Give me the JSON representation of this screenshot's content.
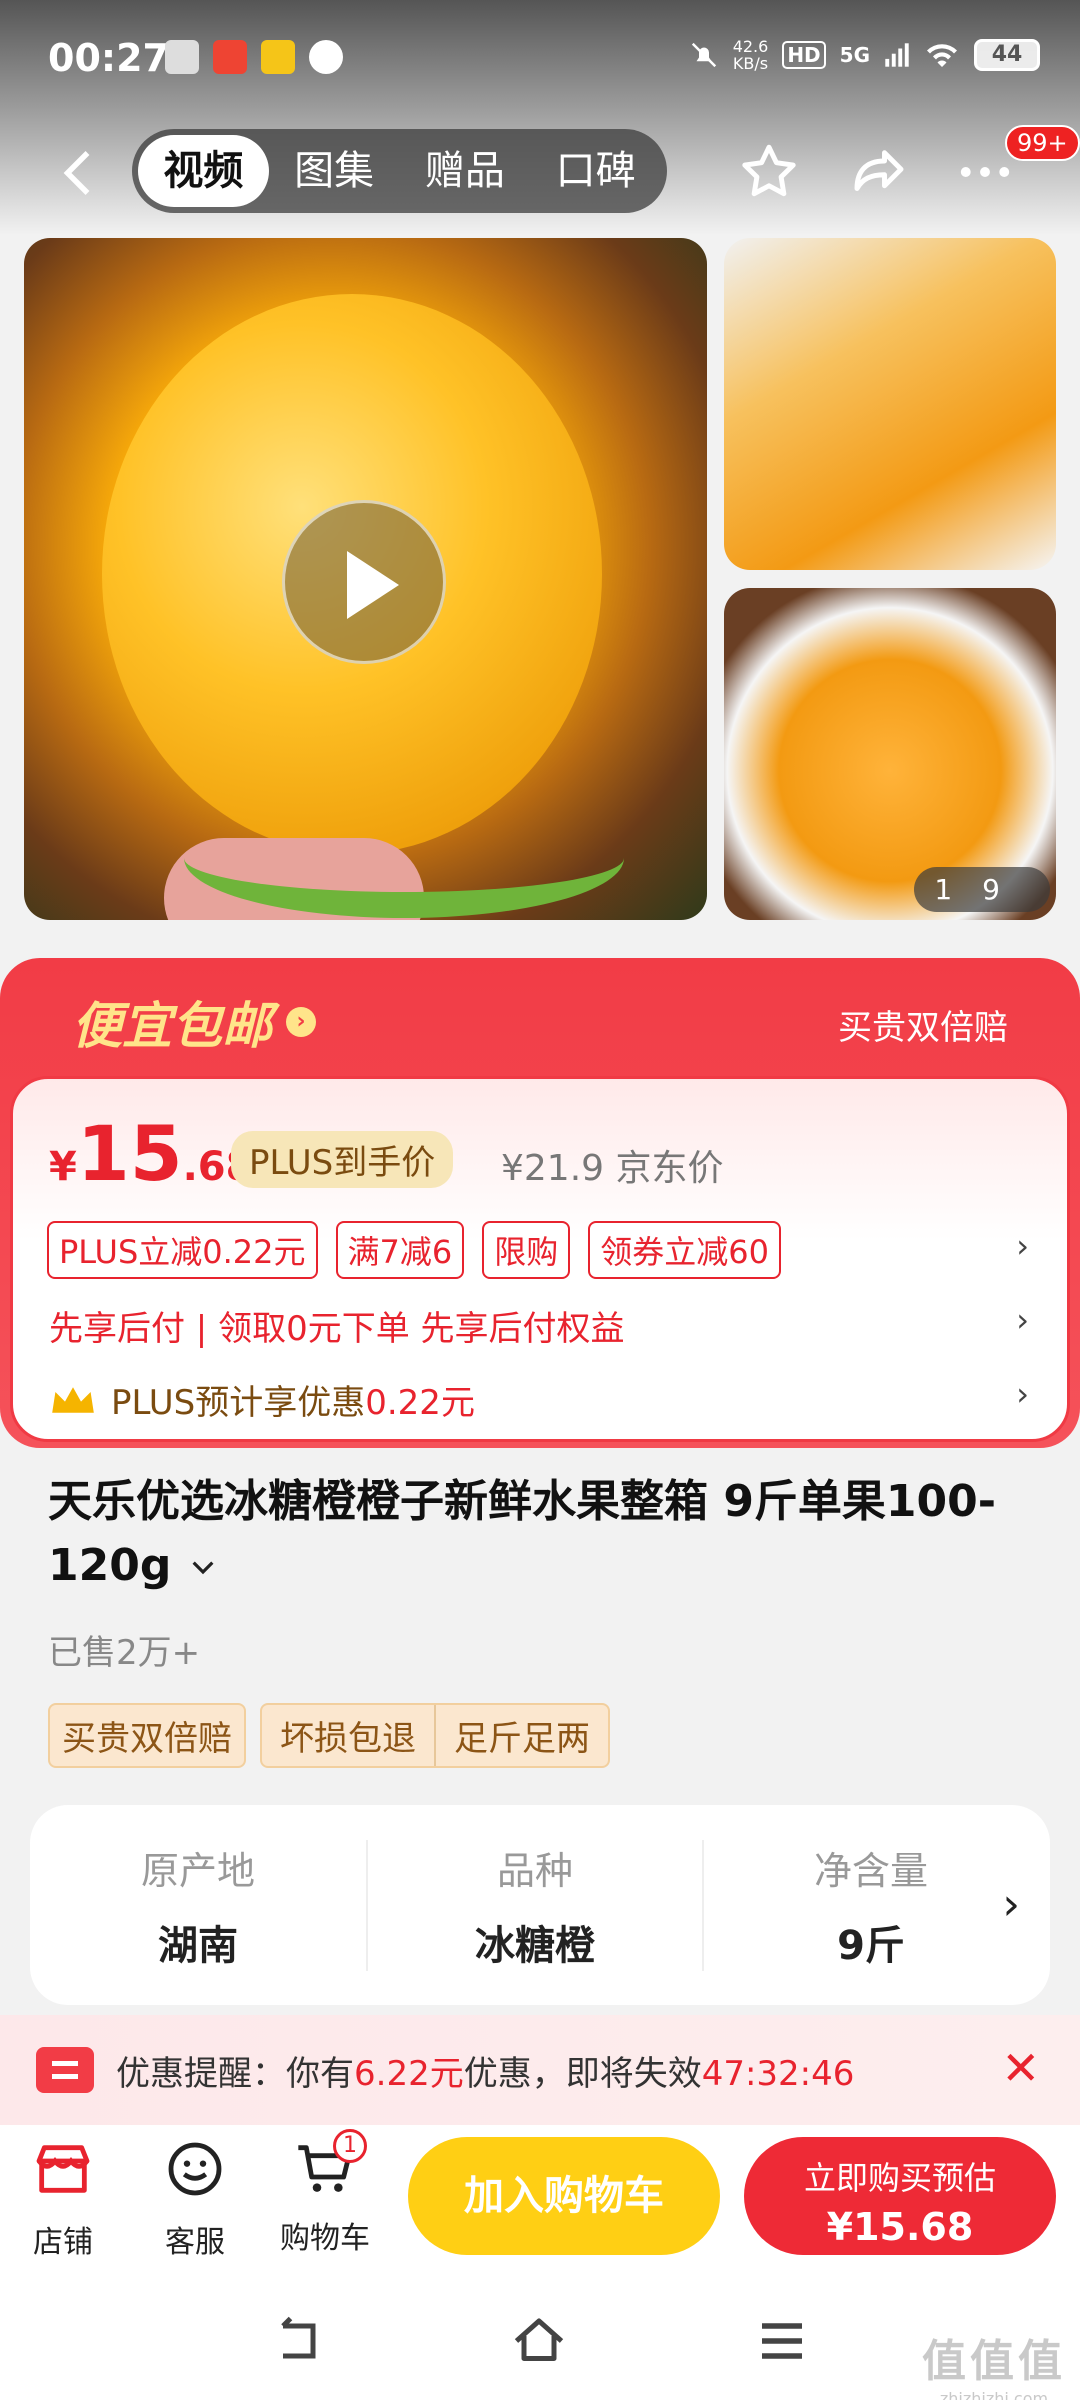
{
  "status_bar": {
    "time": "00:27",
    "speed_value": "42.6",
    "speed_unit": "KB/s",
    "hd": "HD",
    "network": "5G",
    "battery": "44"
  },
  "nav": {
    "tabs": [
      "视频",
      "图集",
      "赠品",
      "口碑"
    ],
    "active_tab": "视频",
    "badge": "99+"
  },
  "gallery": {
    "counter_current": "1",
    "counter_total": "9"
  },
  "promo": {
    "title": "便宜包邮",
    "right_label": "买贵双倍赔",
    "price_symbol": "¥",
    "price_int": "15",
    "price_dec": ".68",
    "plus_label": "PLUS到手价",
    "jd_price": "¥21.9 京东价",
    "coupons": [
      "PLUS立减0.22元",
      "满7减6",
      "限购",
      "领券立减60"
    ],
    "pay_later": "先享后付 | 领取0元下单 先享后付权益",
    "plus_save_prefix": "PLUS预计享优惠",
    "plus_save_amount": "0.22元"
  },
  "product": {
    "title": "天乐优选冰糖橙橙子新鲜水果整箱 9斤单果100-120g",
    "sold": "已售2万+",
    "tag_main": "买贵双倍赔",
    "tag_a": "坏损包退",
    "tag_b": "足斤足两"
  },
  "specs": [
    {
      "key": "原产地",
      "value": "湖南"
    },
    {
      "key": "品种",
      "value": "冰糖橙"
    },
    {
      "key": "净含量",
      "value": "9斤"
    }
  ],
  "reminder": {
    "prefix": "优惠提醒：你有",
    "amount": "6.22元",
    "middle": "优惠，即将失效",
    "countdown": "47:32:46"
  },
  "actionbar": {
    "store": "店铺",
    "service": "客服",
    "cart": "购物车",
    "cart_count": "1",
    "add_cart": "加入购物车",
    "buy_line1": "立即购买预估",
    "buy_line2": "¥15.68"
  },
  "watermark": {
    "main": "值值值",
    "sub": "zhizhizhi.com"
  },
  "colors": {
    "accent_red": "#ee2a36",
    "cart_yellow": "#ffcf14",
    "promo_gold": "#ffe48a"
  }
}
